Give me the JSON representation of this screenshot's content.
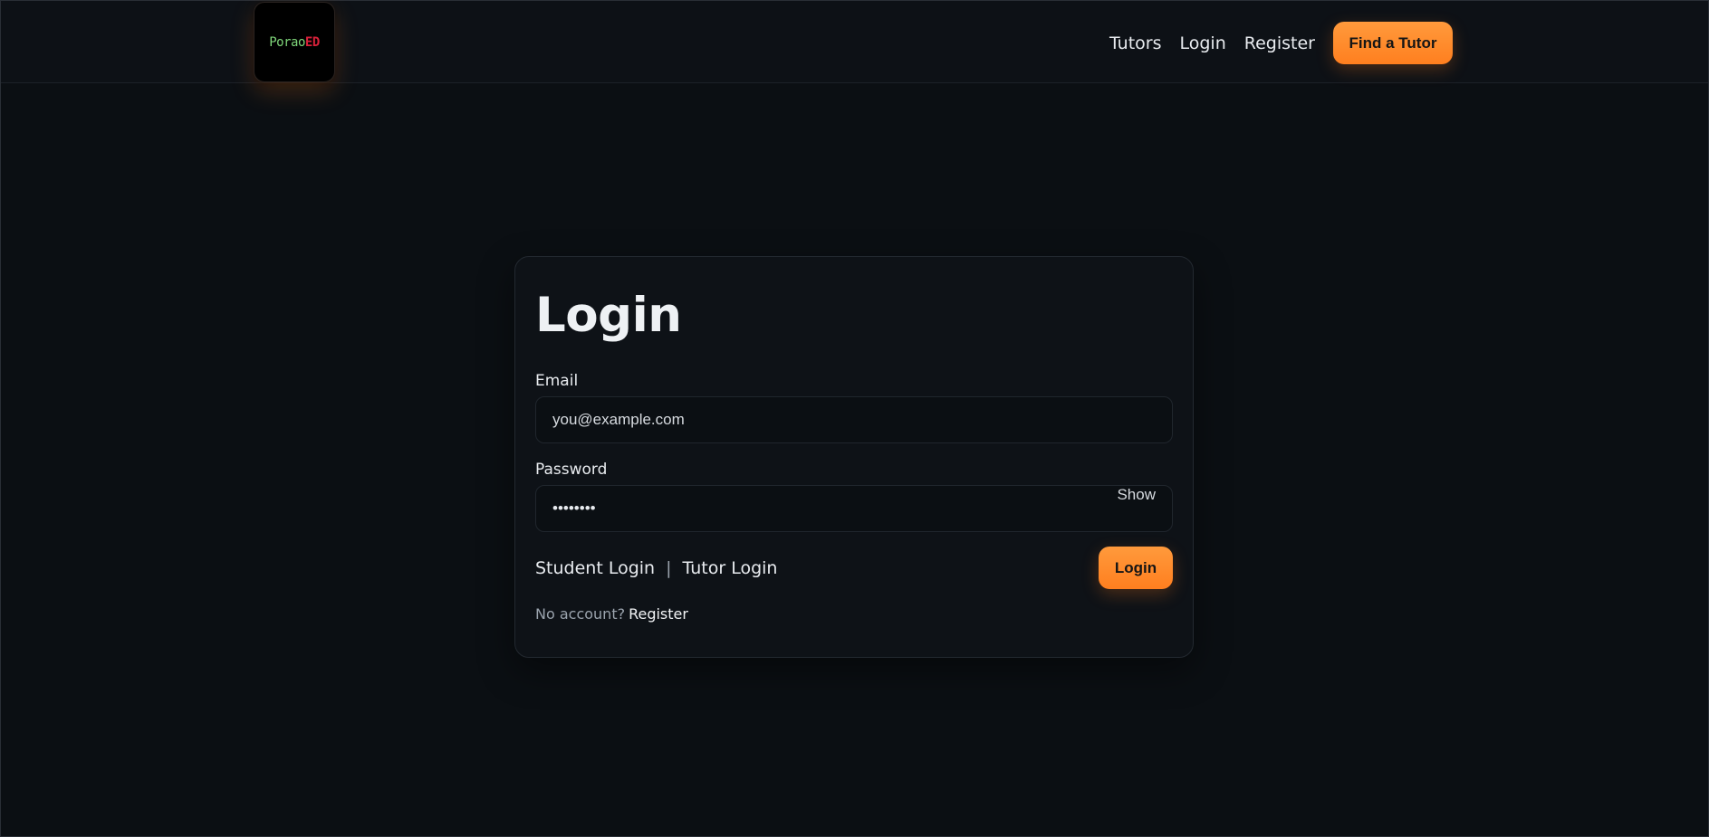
{
  "brand": {
    "logo_text_part1": "Porao",
    "logo_text_part2": "ED"
  },
  "nav": {
    "items": [
      {
        "label": "Tutors"
      },
      {
        "label": "Login"
      },
      {
        "label": "Register"
      }
    ],
    "cta_label": "Find a Tutor"
  },
  "login": {
    "title": "Login",
    "email_label": "Email",
    "email_placeholder": "you@example.com",
    "email_value": "",
    "password_label": "Password",
    "password_value": "••••••••",
    "show_label": "Show",
    "student_login_label": "Student Login",
    "separator": "|",
    "tutor_login_label": "Tutor Login",
    "submit_label": "Login",
    "no_account_text": "No account?",
    "register_link_label": "Register"
  },
  "colors": {
    "background": "#0b0f13",
    "accent": "#ff8a2a",
    "text": "#e8ebef"
  }
}
